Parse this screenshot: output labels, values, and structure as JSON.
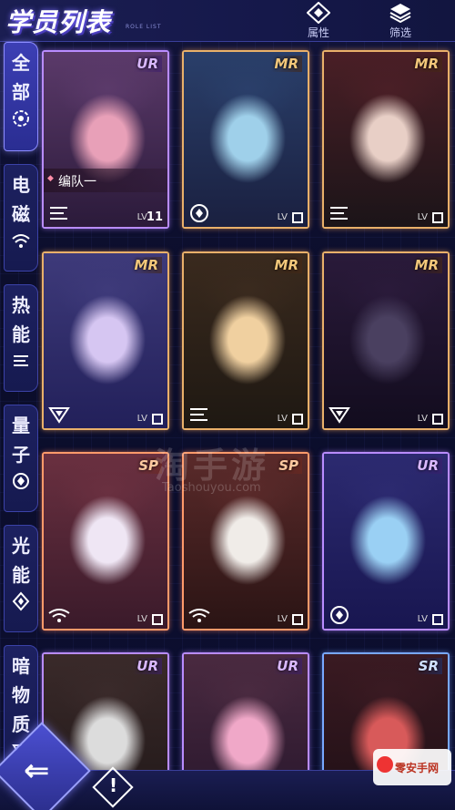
{
  "header": {
    "title": "学员列表",
    "title_sub": "ROLE LIST",
    "attribute_label": "属性",
    "filter_label": "筛选"
  },
  "sidebar": {
    "tabs": [
      {
        "label": "全部",
        "icon": "all-icon",
        "active": true
      },
      {
        "label": "电磁",
        "icon": "wifi-icon",
        "active": false
      },
      {
        "label": "热能",
        "icon": "heat-icon",
        "active": false
      },
      {
        "label": "量子",
        "icon": "quantum-icon",
        "active": false
      },
      {
        "label": "光能",
        "icon": "light-icon",
        "active": false
      },
      {
        "label": "暗物质",
        "icon": "dark-icon",
        "active": false
      }
    ]
  },
  "cards": [
    {
      "rarity": "UR",
      "lv_label": "LV",
      "level": "11",
      "team_tag": "编队一",
      "element": "heat-icon"
    },
    {
      "rarity": "MR",
      "lv_label": "LV",
      "level": "",
      "element": "quantum-icon"
    },
    {
      "rarity": "MR",
      "lv_label": "LV",
      "level": "",
      "element": "heat-icon"
    },
    {
      "rarity": "MR",
      "lv_label": "LV",
      "level": "",
      "element": "dark-icon"
    },
    {
      "rarity": "MR",
      "lv_label": "LV",
      "level": "",
      "element": "heat-icon"
    },
    {
      "rarity": "MR",
      "lv_label": "LV",
      "level": "",
      "element": "dark-icon"
    },
    {
      "rarity": "SP",
      "lv_label": "LV",
      "level": "",
      "element": "wifi-icon"
    },
    {
      "rarity": "SP",
      "lv_label": "LV",
      "level": "",
      "element": "wifi-icon"
    },
    {
      "rarity": "UR",
      "lv_label": "LV",
      "level": "",
      "element": "quantum-icon"
    },
    {
      "rarity": "UR",
      "lv_label": "LV",
      "level": "",
      "element": "none"
    },
    {
      "rarity": "UR",
      "lv_label": "LV",
      "level": "",
      "element": "none"
    },
    {
      "rarity": "SR",
      "lv_label": "LV",
      "level": "",
      "element": "none"
    }
  ],
  "watermark": {
    "main": "淘手游",
    "sub": "Taoshouyou.com"
  },
  "logo": {
    "text": "零安手网"
  }
}
